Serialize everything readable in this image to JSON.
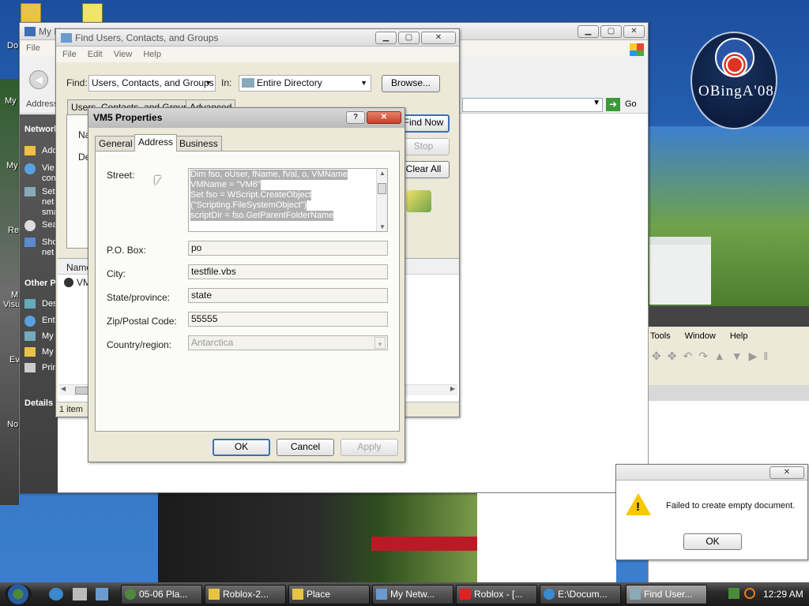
{
  "desktop": {
    "icons": [
      "Do",
      "My",
      "My",
      "Re",
      "My"
    ],
    "left_labels": [
      "Do",
      "My",
      "My",
      "Re",
      "M",
      "Visu",
      "Ev",
      "No"
    ],
    "obama_text": "OBingA'08"
  },
  "network_window": {
    "title": "My N",
    "menu": [
      "File"
    ],
    "address_label": "Address",
    "go_label": "Go",
    "tasks_header": "Network",
    "task_items": [
      "Add",
      "Vie con",
      "Set net sma",
      "Sea",
      "Sho net"
    ],
    "other_places_header": "Other P",
    "other_items": [
      "Des",
      "Ent",
      "My",
      "My",
      "Prin"
    ],
    "details_header": "Details"
  },
  "find_window": {
    "title": "Find Users, Contacts, and Groups",
    "menu": [
      "File",
      "Edit",
      "View",
      "Help"
    ],
    "find_label": "Find:",
    "find_value": "Users, Contacts, and Groups",
    "in_label": "In:",
    "in_value": "Entire Directory",
    "browse_label": "Browse...",
    "tabs": [
      "Users, Contacts, and Groups",
      "Advanced"
    ],
    "find_now_label": "Find Now",
    "stop_label": "Stop",
    "clear_all_label": "Clear All",
    "name_label_1": "Na",
    "desc_label": "De",
    "results_header": "Name",
    "results_row": "VM",
    "status": "1 item"
  },
  "props": {
    "title": "VM5 Properties",
    "tabs": [
      "General",
      "Address",
      "Business"
    ],
    "street_label": "Street:",
    "street_lines": [
      "Dim fso, oUser, fName, fVal, o, VMName",
      "VMName = \"VM6\"",
      "Set fso = WScript.CreateObject",
      "(\"Scripting.FileSystemObject\")",
      "scriptDir = fso.GetParentFolderName"
    ],
    "pobox_label": "P.O. Box:",
    "pobox_value": "po",
    "city_label": "City:",
    "city_value": "testfile.vbs",
    "state_label": "State/province:",
    "state_value": "state",
    "zip_label": "Zip/Postal Code:",
    "zip_value": "55555",
    "country_label": "Country/region:",
    "country_value": "Antarctica",
    "ok_label": "OK",
    "cancel_label": "Cancel",
    "apply_label": "Apply"
  },
  "app_window": {
    "menu": [
      "Tools",
      "Window",
      "Help"
    ]
  },
  "error_dialog": {
    "message": "Failed to create empty document.",
    "ok_label": "OK"
  },
  "taskbar": {
    "buttons": [
      "05-06 Pla...",
      "Roblox-2...",
      "Place",
      "My Netw...",
      "Roblox - [...",
      "E:\\Docum...",
      "Find User..."
    ],
    "clock": "12:29 AM"
  }
}
